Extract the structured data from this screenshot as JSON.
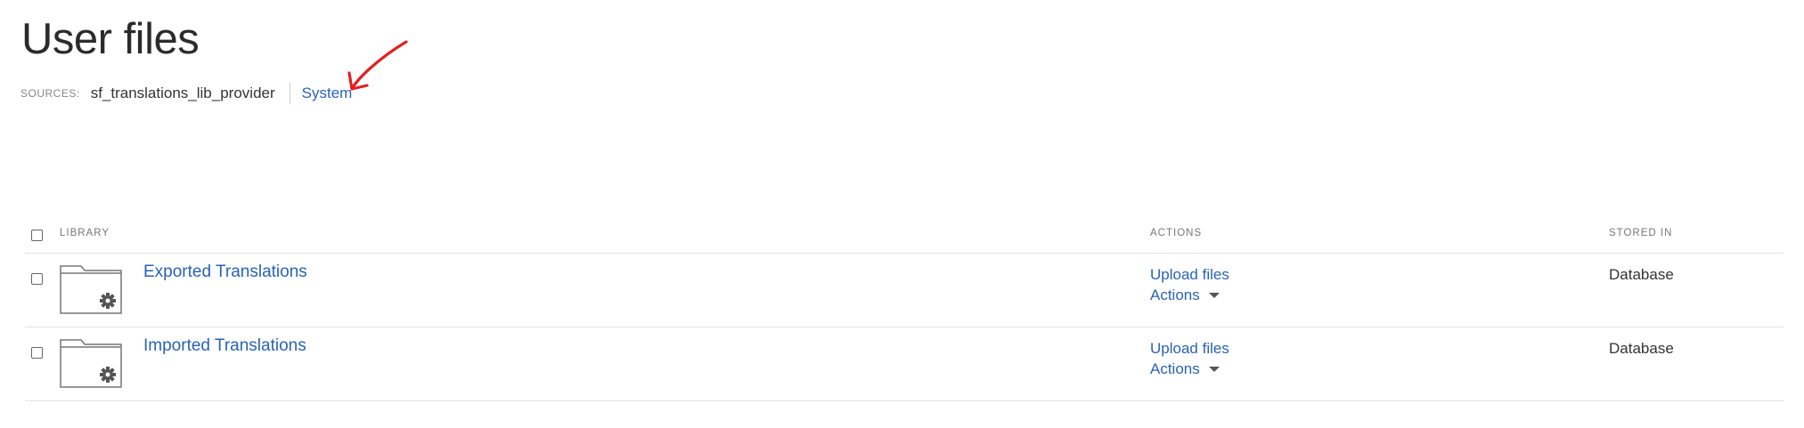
{
  "page": {
    "title": "User files"
  },
  "sources": {
    "label": "SOURCES:",
    "current": "sf_translations_lib_provider",
    "link": "System"
  },
  "table": {
    "headers": {
      "library": "LIBRARY",
      "actions": "ACTIONS",
      "stored_in": "STORED IN"
    },
    "rows": [
      {
        "library": "Exported Translations",
        "upload_label": "Upload files",
        "actions_label": "Actions",
        "stored_in": "Database"
      },
      {
        "library": "Imported Translations",
        "upload_label": "Upload files",
        "actions_label": "Actions",
        "stored_in": "Database"
      }
    ]
  },
  "colors": {
    "link": "#2a63b3",
    "annotation_arrow": "#e02020",
    "divider": "#e2e2e2"
  },
  "icons": {
    "folder": "folder-gear-icon",
    "annotation": "red-arrow-annotation",
    "dropdown": "caret-down-icon"
  }
}
